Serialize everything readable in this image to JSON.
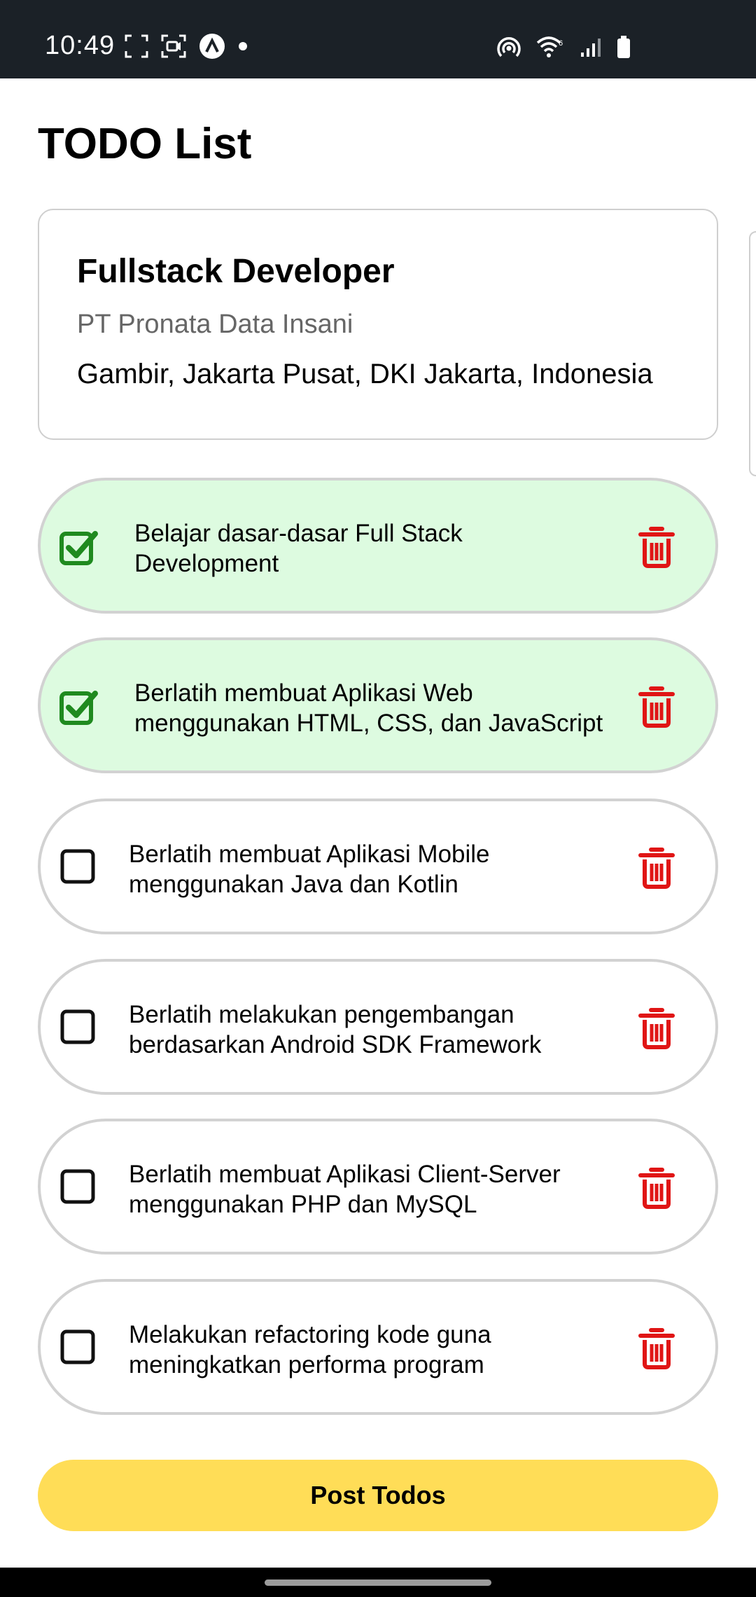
{
  "status_bar": {
    "time": "10:49",
    "left_icons": [
      "screenshot-frame-icon",
      "screen-record-icon",
      "app-notification-icon",
      "dot-icon"
    ],
    "right_icons": [
      "hotspot-icon",
      "wifi-icon",
      "signal-icon",
      "battery-icon"
    ],
    "background": "#1b2127"
  },
  "page": {
    "title": "TODO List"
  },
  "job": {
    "title": "Fullstack Developer",
    "company": "PT Pronata Data Insani",
    "location": "Gambir, Jakarta Pusat, DKI Jakarta, Indonesia"
  },
  "todos": [
    {
      "line1": "Belajar dasar-dasar Full Stack",
      "line2": "Development",
      "done": true
    },
    {
      "line1": "Berlatih membuat Aplikasi Web",
      "line2": "menggunakan HTML, CSS, dan JavaScript",
      "done": true
    },
    {
      "line1": "Berlatih membuat Aplikasi Mobile",
      "line2": "menggunakan Java dan Kotlin",
      "done": false
    },
    {
      "line1": "Berlatih melakukan pengembangan",
      "line2": "berdasarkan Android SDK Framework",
      "done": false
    },
    {
      "line1": "Berlatih membuat Aplikasi Client-Server",
      "line2": "menggunakan PHP dan MySQL",
      "done": false
    },
    {
      "line1": "Melakukan refactoring kode guna",
      "line2": "meningkatkan performa program",
      "done": false
    }
  ],
  "actions": {
    "post_label": "Post Todos"
  },
  "colors": {
    "done_background": "#ddfbe0",
    "check_green": "#1f8a1f",
    "delete_red": "#e01515",
    "post_button": "#ffdd57",
    "item_border": "#d2d2d2"
  }
}
